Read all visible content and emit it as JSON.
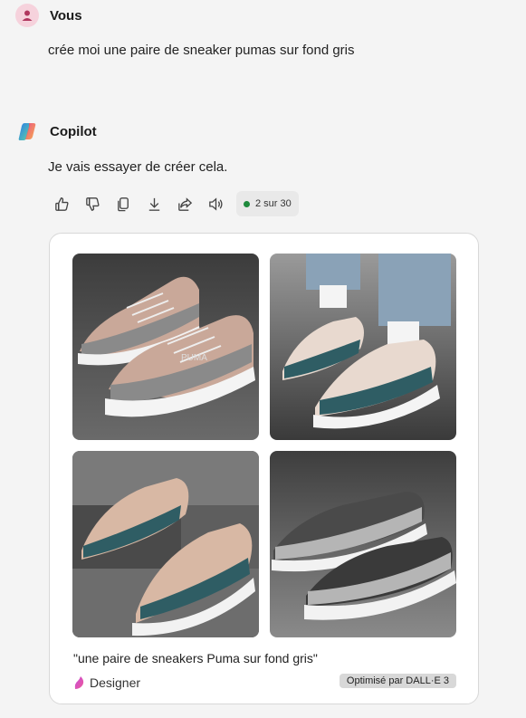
{
  "user_message": {
    "author": "Vous",
    "text": "crée moi une paire de sneaker pumas sur fond gris"
  },
  "copilot_message": {
    "author": "Copilot",
    "text": "Je vais essayer de créer cela.",
    "toolbar": {
      "icons": [
        "thumbs-up-icon",
        "thumbs-down-icon",
        "copy-icon",
        "download-icon",
        "share-icon",
        "speaker-icon"
      ],
      "counter": "2 sur 30"
    },
    "result_card": {
      "images": [
        {
          "description_icon": "sneaker-image"
        },
        {
          "description_icon": "sneaker-image"
        },
        {
          "description_icon": "sneaker-image"
        },
        {
          "description_icon": "sneaker-image"
        }
      ],
      "caption": "\"une paire de sneakers Puma sur fond gris\"",
      "designer_label": "Designer",
      "badge": "Optimisé par DALL·E 3"
    }
  },
  "colors": {
    "background": "#f4f4f4",
    "status_dot": "#1e8a3c",
    "avatar_user": "#f6d2dc"
  }
}
